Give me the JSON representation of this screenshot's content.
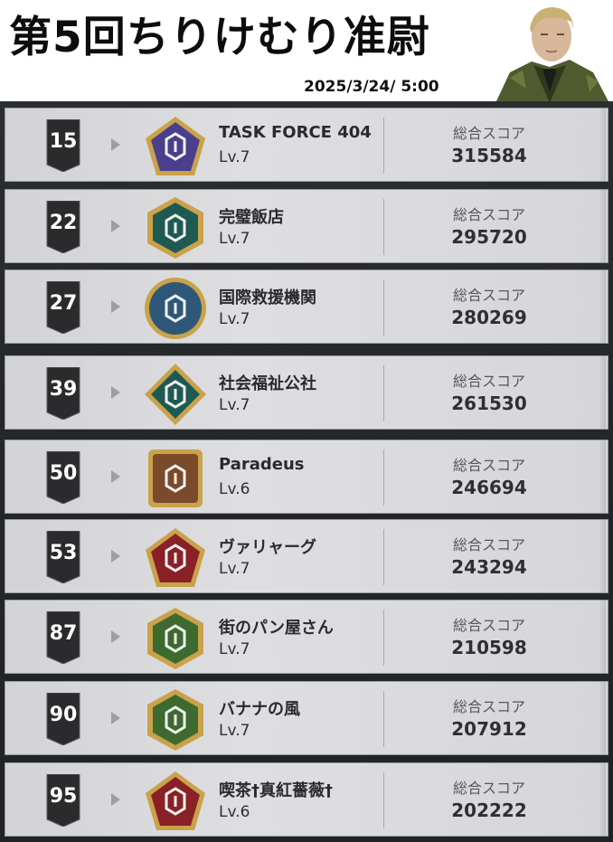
{
  "header": {
    "title": "第5回ちりけむり准尉",
    "date": "2025/3/24/ 5:00"
  },
  "score_label": "総合スコア",
  "entries": [
    {
      "rank": "15",
      "name": "TASK FORCE 404",
      "level": "Lv.7",
      "score": "315584",
      "emblem": "purple-pentagon-emblem",
      "emblem_color": "#4a3f8c"
    },
    {
      "rank": "22",
      "name": "完璧飯店",
      "level": "Lv.7",
      "score": "295720",
      "emblem": "teal-hexagon-emblem",
      "emblem_color": "#1f5a52"
    },
    {
      "rank": "27",
      "name": "国際救援機関",
      "level": "Lv.7",
      "score": "280269",
      "emblem": "blue-round-emblem",
      "emblem_color": "#2f5878"
    },
    {
      "rank": "39",
      "name": "社会福祉公社",
      "level": "Lv.7",
      "score": "261530",
      "emblem": "teal-diamond-emblem",
      "emblem_color": "#1f5a52"
    },
    {
      "rank": "50",
      "name": "Paradeus",
      "level": "Lv.6",
      "score": "246694",
      "emblem": "brown-square-emblem",
      "emblem_color": "#7a4a2a"
    },
    {
      "rank": "53",
      "name": "ヴァリャーグ",
      "level": "Lv.7",
      "score": "243294",
      "emblem": "red-pentagon-emblem",
      "emblem_color": "#8a2126"
    },
    {
      "rank": "87",
      "name": "街のパン屋さん",
      "level": "Lv.7",
      "score": "210598",
      "emblem": "green-hexagon-emblem",
      "emblem_color": "#3d6a2e"
    },
    {
      "rank": "90",
      "name": "バナナの風",
      "level": "Lv.7",
      "score": "207912",
      "emblem": "green-hexagon-emblem",
      "emblem_color": "#3d6a2e"
    },
    {
      "rank": "95",
      "name": "喫茶†真紅薔薇†",
      "level": "Lv.6",
      "score": "202222",
      "emblem": "red-pentagon-emblem",
      "emblem_color": "#8a2126"
    }
  ]
}
